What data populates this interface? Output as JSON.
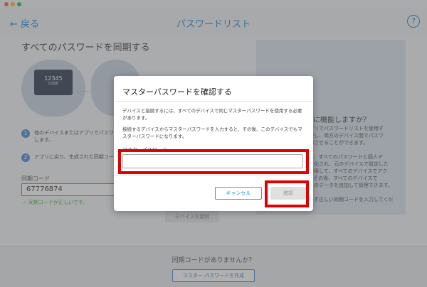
{
  "window": {
    "traffic_colors": [
      "#ff5f57",
      "#febc2e",
      "#28c840"
    ]
  },
  "header": {
    "back_label": "← 戻る",
    "title": "パスワードリスト",
    "help_label": "?"
  },
  "left_panel": {
    "title": "すべてのパスワードを同期する",
    "laptop_screen_code": "12345",
    "laptop_screen_sub": "CODE",
    "steps": [
      {
        "num": "1",
        "text": "他のデバイスまたはアプリでパスワー\nします。"
      },
      {
        "num": "2",
        "text": "アプリに戻り、生成された同期コード"
      }
    ],
    "code_label": "同期コード",
    "code_value": "67776874",
    "code_ok": "同期コードが正しいです。",
    "device_button": "デバイスを接続"
  },
  "right_panel": {
    "title": "ように機能しますか？",
    "text": "のアプリでパスワードリストを使用す\nを接続し、両方のデバイス間でパスワ\nを同期させることができます。\n\nことで、すべてのパスワードと個人デ\nが暗号化され、元のデバイスで設定した\nドを使用して、すべてのデバイスでアク\nです。その後、すべてのデバイスで\nリストのデータを追加して管理できます。\n\nは、必ず正しい同期コードを入力してくだ"
  },
  "bottom_bar": {
    "no_code_text": "同期コードがありませんか？",
    "create_button": "マスター パスワードを作成"
  },
  "dialog": {
    "title": "マスターパスワードを確認する",
    "paragraph1": "デバイスと接続するには、すべてのデバイスで同じマスターパスワードを使用する必要があります。",
    "paragraph2": "接続するデバイスからマスターパスワードを入力すると、その後、このデバイスでもマスターパスワードになります。",
    "password_label": "マスターパスワード",
    "password_value": "",
    "cancel_label": "キャンセル",
    "confirm_label": "確認"
  },
  "highlights": {
    "color": "#e00000"
  }
}
